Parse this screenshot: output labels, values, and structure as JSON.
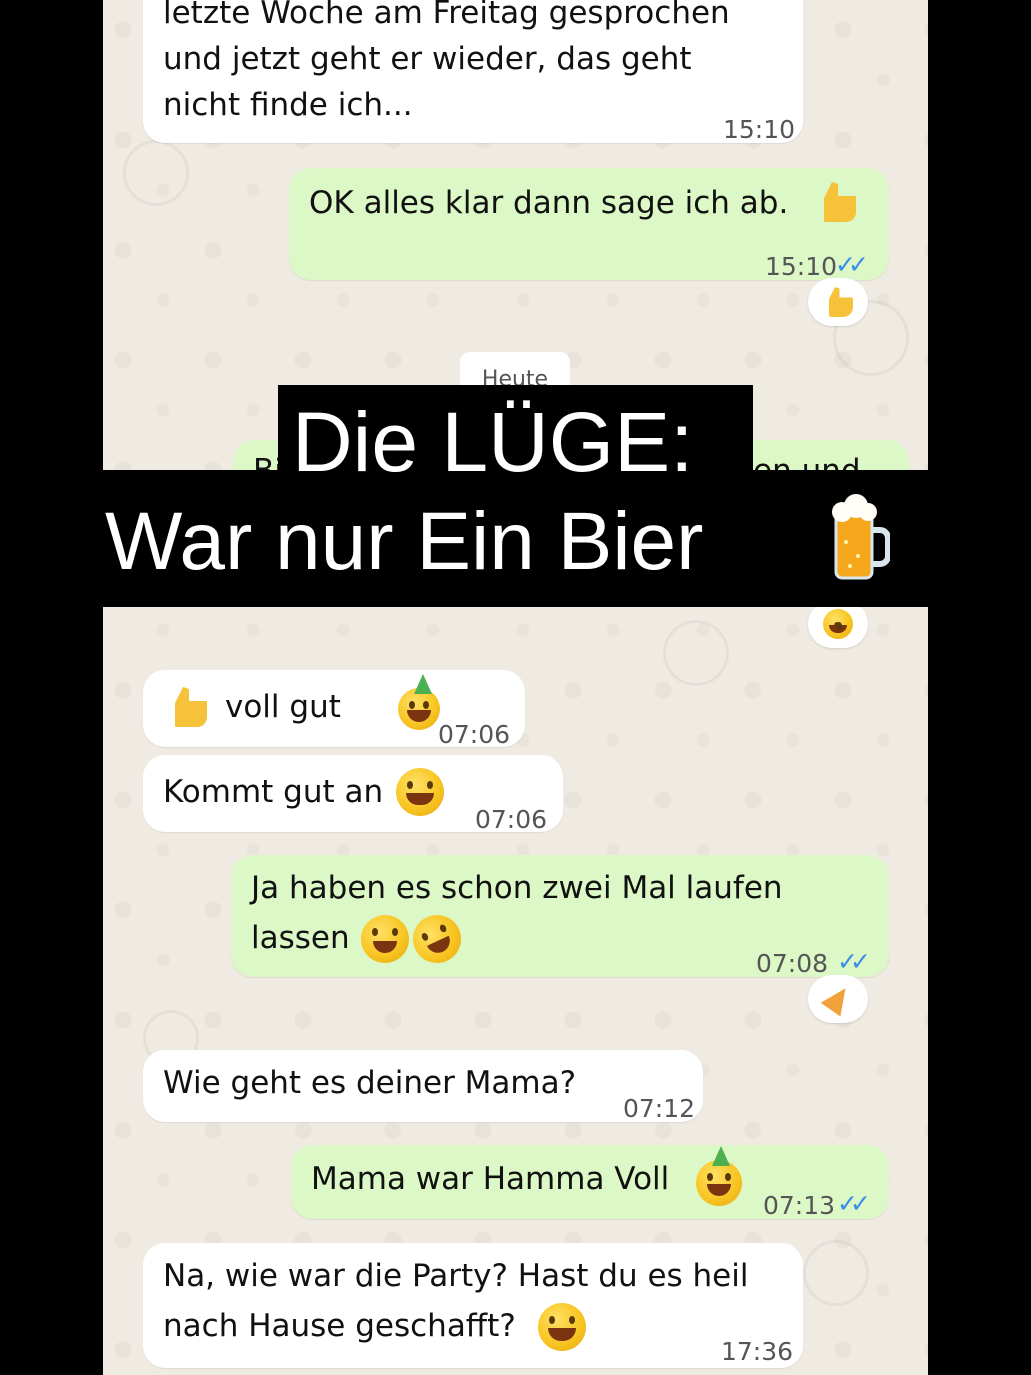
{
  "chat": {
    "messages": [
      {
        "id": "m1",
        "direction": "incoming",
        "lines": [
          "letzte Woche am Freitag gesprochen",
          "und jetzt geht er wieder, das geht",
          "nicht finde ich..."
        ],
        "time": "15:10"
      },
      {
        "id": "m2",
        "direction": "outgoing",
        "text": "OK alles klar dann sage ich ab.",
        "emoji": "thumbs-up",
        "time": "15:10",
        "status": "read",
        "reaction": "thumbs-up"
      },
      {
        "id": "m3",
        "direction": "incoming",
        "text": "voll gut",
        "emoji_before": "thumbs-up",
        "emoji_after": "party-face",
        "time": "07:06"
      },
      {
        "id": "m4",
        "direction": "incoming",
        "text": "Kommt gut an",
        "emoji": "grinning-face",
        "time": "07:06"
      },
      {
        "id": "m5",
        "direction": "outgoing",
        "lines": [
          "Ja haben es schon zwei Mal laufen",
          "lassen"
        ],
        "emoji": [
          "party-face",
          "rolling-laughing-face"
        ],
        "time": "07:08",
        "status": "read",
        "reaction": "party-popper"
      },
      {
        "id": "m6",
        "direction": "incoming",
        "text": "Wie geht es deiner Mama?",
        "time": "07:12"
      },
      {
        "id": "m7",
        "direction": "outgoing",
        "text": "Mama war Hamma Voll",
        "emoji": "party-face",
        "time": "07:13",
        "status": "read"
      },
      {
        "id": "m8",
        "direction": "incoming",
        "lines": [
          "Na, wie war die Party? Hast du es heil",
          "nach Hause geschafft?"
        ],
        "emoji": "grinning-face",
        "time": "17:36"
      }
    ],
    "day_separator": "Heute",
    "hidden_message_fragment_left": "Bi",
    "hidden_message_fragment_right": "en und",
    "hidden_reaction": "laughing-face",
    "colors": {
      "incoming": "#ffffff",
      "outgoing": "#dcf8c6",
      "ticks": "#3a8de8",
      "wallpaper": "#efeae2"
    }
  },
  "overlay": {
    "line1": "Die LÜGE:",
    "line2": "War nur Ein Bier",
    "icon": "beer-mug-icon"
  }
}
